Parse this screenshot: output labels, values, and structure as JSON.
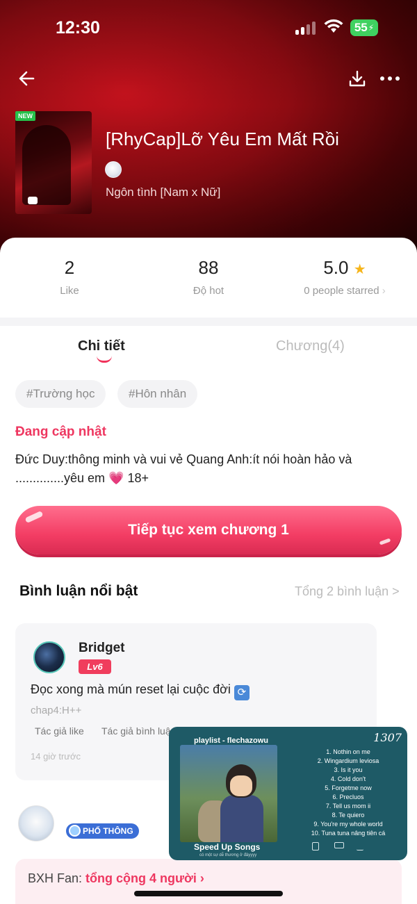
{
  "status_bar": {
    "time": "12:30",
    "battery": "55"
  },
  "story": {
    "new_badge": "NEW",
    "title": "[RhyCap]Lỡ Yêu Em Mất Rồi",
    "genre": "Ngôn tình [Nam x Nữ]"
  },
  "stats": [
    {
      "value": "2",
      "label": "Like"
    },
    {
      "value": "88",
      "label": "Độ hot"
    },
    {
      "value": "5.0",
      "label": "0 people starred",
      "chevron": "›"
    }
  ],
  "tabs": {
    "detail": "Chi tiết",
    "chapters": "Chương(4)"
  },
  "tags": [
    "#Trường học",
    "#Hôn nhân"
  ],
  "status_text": "Đang cập nhật",
  "description": "Đức Duy:thông minh và vui vẻ Quang Anh:ít nói hoàn hảo và ..............yêu em 💗 18+",
  "cta_label": "Tiếp tục xem chương 1",
  "comments_section": {
    "title": "Bình luận nổi bật",
    "total": "Tổng 2 bình luận >"
  },
  "comment": {
    "name": "Bridget",
    "level": "Lv6",
    "text": "Đọc xong mà mún reset lại cuộc đời",
    "chapter": "chap4:H++",
    "tag1": "Tác giả like",
    "tag2": "Tác giả bình luận",
    "time": "14 giờ trước"
  },
  "user2_badge": "PHỔ THÔNG",
  "fan": {
    "prefix": "BXH Fan:",
    "count": "tổng cộng 4 người",
    "chevron": "›"
  },
  "playlist": {
    "header": "playlist - flechazowu",
    "logo": "1307",
    "title": "Speed Up Songs",
    "subtitle": "có một sự dễ thương ở đâyyyy",
    "songs": [
      "1. Nothin on me",
      "2. Wingardium leviosa",
      "3. Is it you",
      "4. Cold don't",
      "5. Forgetme now",
      "6. Precluos",
      "7. Tell us mom ii",
      "8. Te quiero",
      "9. You're my whole world",
      "10. Tuna tuna nâng tiên cá"
    ]
  }
}
